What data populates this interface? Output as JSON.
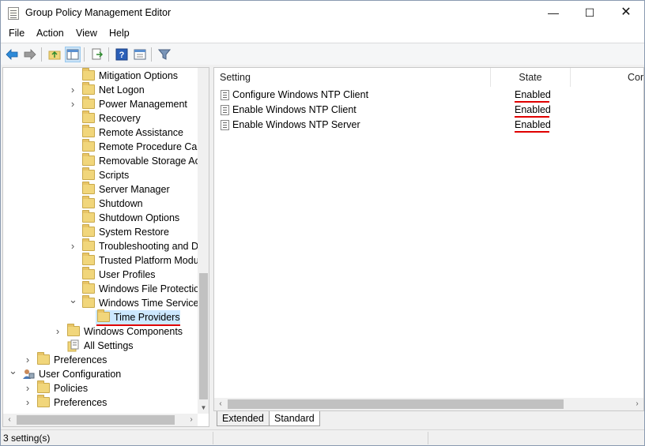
{
  "window": {
    "title": "Group Policy Management Editor",
    "minimize": "—",
    "maximize": "☐",
    "close": "✕"
  },
  "menu": [
    "File",
    "Action",
    "View",
    "Help"
  ],
  "toolbar": {
    "icons": [
      "back-icon",
      "forward-icon",
      "up-folder-icon",
      "show-hide-tree-icon",
      "export-list-icon",
      "help-icon",
      "properties-icon",
      "filter-icon"
    ]
  },
  "tree": {
    "items": [
      {
        "label": "Mitigation Options",
        "expander": ""
      },
      {
        "label": "Net Logon",
        "expander": ">"
      },
      {
        "label": "Power Management",
        "expander": ">"
      },
      {
        "label": "Recovery",
        "expander": ""
      },
      {
        "label": "Remote Assistance",
        "expander": ""
      },
      {
        "label": "Remote Procedure Call",
        "expander": ""
      },
      {
        "label": "Removable Storage Acc",
        "expander": ""
      },
      {
        "label": "Scripts",
        "expander": ""
      },
      {
        "label": "Server Manager",
        "expander": ""
      },
      {
        "label": "Shutdown",
        "expander": ""
      },
      {
        "label": "Shutdown Options",
        "expander": ""
      },
      {
        "label": "System Restore",
        "expander": ""
      },
      {
        "label": "Troubleshooting and Di",
        "expander": ">"
      },
      {
        "label": "Trusted Platform Modul",
        "expander": ""
      },
      {
        "label": "User Profiles",
        "expander": ""
      },
      {
        "label": "Windows File Protectior",
        "expander": ""
      },
      {
        "label": "Windows Time Service",
        "expander": "v"
      },
      {
        "label": "Time Providers",
        "expander": ""
      },
      {
        "label": "Windows Components",
        "expander": ">"
      },
      {
        "label": "All Settings",
        "expander": ""
      },
      {
        "label": "Preferences",
        "expander": ">"
      },
      {
        "label": "User Configuration",
        "expander": "v"
      },
      {
        "label": "Policies",
        "expander": ">"
      },
      {
        "label": "Preferences",
        "expander": ">"
      }
    ],
    "selected": "Time Providers"
  },
  "list": {
    "columns": [
      "Setting",
      "State",
      "Cor"
    ],
    "rows": [
      {
        "setting": "Configure Windows NTP Client",
        "state": "Enabled"
      },
      {
        "setting": "Enable Windows NTP Client",
        "state": "Enabled"
      },
      {
        "setting": "Enable Windows NTP Server",
        "state": "Enabled"
      }
    ]
  },
  "tabs": [
    "Extended",
    "Standard"
  ],
  "status": {
    "text": "3 setting(s)"
  },
  "colors": {
    "highlight": "#cce8ff",
    "annotation_red": "#e00000"
  }
}
